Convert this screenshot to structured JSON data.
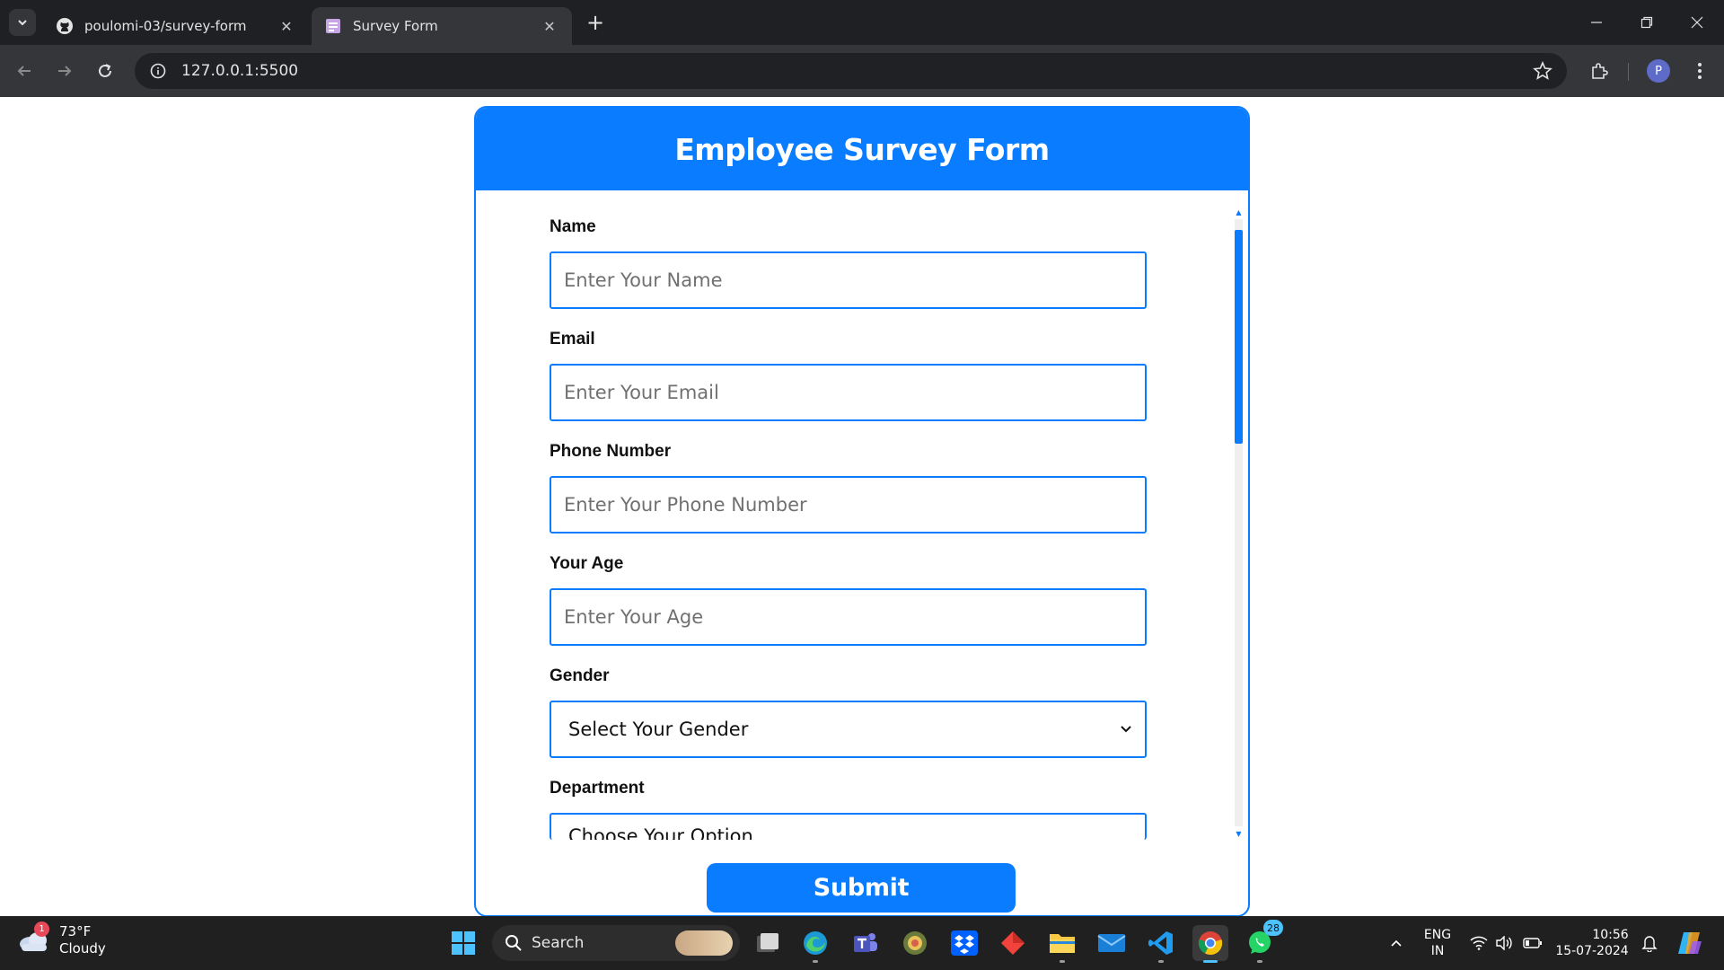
{
  "browser": {
    "tabs": [
      {
        "title": "poulomi-03/survey-form",
        "favicon": "github-icon"
      },
      {
        "title": "Survey Form",
        "favicon": "page-icon",
        "active": true
      }
    ],
    "url": "127.0.0.1:5500",
    "profile_initial": "P"
  },
  "form": {
    "title": "Employee Survey Form",
    "fields": [
      {
        "label": "Name",
        "placeholder": "Enter Your Name",
        "type": "text"
      },
      {
        "label": "Email",
        "placeholder": "Enter Your Email",
        "type": "email"
      },
      {
        "label": "Phone Number",
        "placeholder": "Enter Your Phone Number",
        "type": "tel"
      },
      {
        "label": "Your Age",
        "placeholder": "Enter Your Age",
        "type": "number"
      },
      {
        "label": "Gender",
        "selected": "Select Your Gender",
        "type": "select"
      },
      {
        "label": "Department",
        "selected": "Choose Your Option",
        "type": "select"
      }
    ],
    "submit_label": "Submit",
    "accent_color": "#0a7cff"
  },
  "taskbar": {
    "weather": {
      "temp": "73°F",
      "condition": "Cloudy",
      "badge": "1"
    },
    "search_label": "Search",
    "whatsapp_badge": "28",
    "language": {
      "line1": "ENG",
      "line2": "IN"
    },
    "time": "10:56",
    "date": "15-07-2024"
  }
}
